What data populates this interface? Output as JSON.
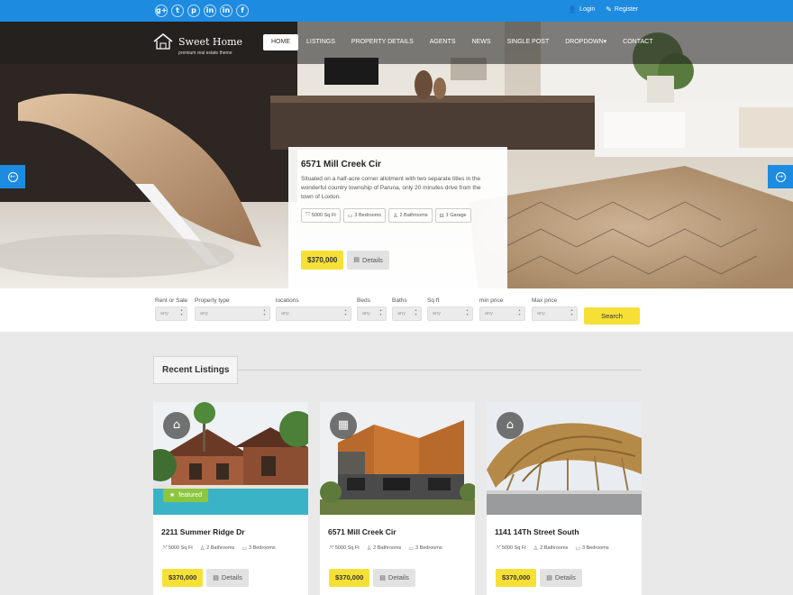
{
  "topbar": {
    "social": [
      "g+",
      "t",
      "p",
      "in",
      "in",
      "f"
    ],
    "social_icons": [
      "google-plus-icon",
      "twitter-icon",
      "pinterest-icon",
      "dribbble-icon",
      "linkedin-icon",
      "facebook-icon"
    ],
    "login": "Login",
    "register": "Register"
  },
  "brand": {
    "name": "Sweet Home",
    "tagline": "premium real estate theme"
  },
  "nav": [
    {
      "label": "HOME",
      "active": true
    },
    {
      "label": "LISTINGS"
    },
    {
      "label": "PROPERTY DETAILS"
    },
    {
      "label": "AGENTS"
    },
    {
      "label": "NEWS"
    },
    {
      "label": "SINGLE POST"
    },
    {
      "label": "DROPDOWN▾"
    },
    {
      "label": "CONTACT"
    }
  ],
  "hero": {
    "title": "6571 Mill Creek Cir",
    "description": "Situated on a half-acre corner allotment with two separate titles in the wonderful country township of Paruna, only 20 minutes drive from the town of Loxton.",
    "features": [
      "5000 Sq Ft",
      "3 Bedrooms",
      "2 Bathrooms",
      "1 Garage"
    ],
    "price": "$370,000",
    "details": "Details"
  },
  "search": {
    "fields": [
      {
        "label": "Rent or Sale",
        "value": "any"
      },
      {
        "label": "Property type",
        "value": "any"
      },
      {
        "label": "locations",
        "value": "any"
      },
      {
        "label": "Beds",
        "value": "any"
      },
      {
        "label": "Baths",
        "value": "any"
      },
      {
        "label": "Sq ft",
        "value": "any"
      },
      {
        "label": "min price",
        "value": "any"
      },
      {
        "label": "Max price",
        "value": "any"
      }
    ],
    "button": "Search"
  },
  "recent": {
    "title": "Recent Listings",
    "cards": [
      {
        "title": "2211 Summer Ridge Dr",
        "sqft": "5000 Sq Ft",
        "baths": "2 Bathrooms",
        "beds": "3 Bedrooms",
        "price": "$370,000",
        "details": "Details",
        "badge_icon": "home-icon",
        "featured": "featured"
      },
      {
        "title": "6571 Mill Creek Cir",
        "sqft": "5000 Sq Ft",
        "baths": "2 Bathrooms",
        "beds": "3 Bedrooms",
        "price": "$370,000",
        "details": "Details",
        "badge_icon": "building-icon"
      },
      {
        "title": "1141 14Th Street South",
        "sqft": "5000 Sq Ft",
        "baths": "2 Bathrooms",
        "beds": "3 Bedrooms",
        "price": "$370,000",
        "details": "Details",
        "badge_icon": "home-icon"
      }
    ]
  },
  "colors": {
    "accent": "#1d8be0",
    "price": "#f7e036",
    "featured": "#8cc63f"
  }
}
